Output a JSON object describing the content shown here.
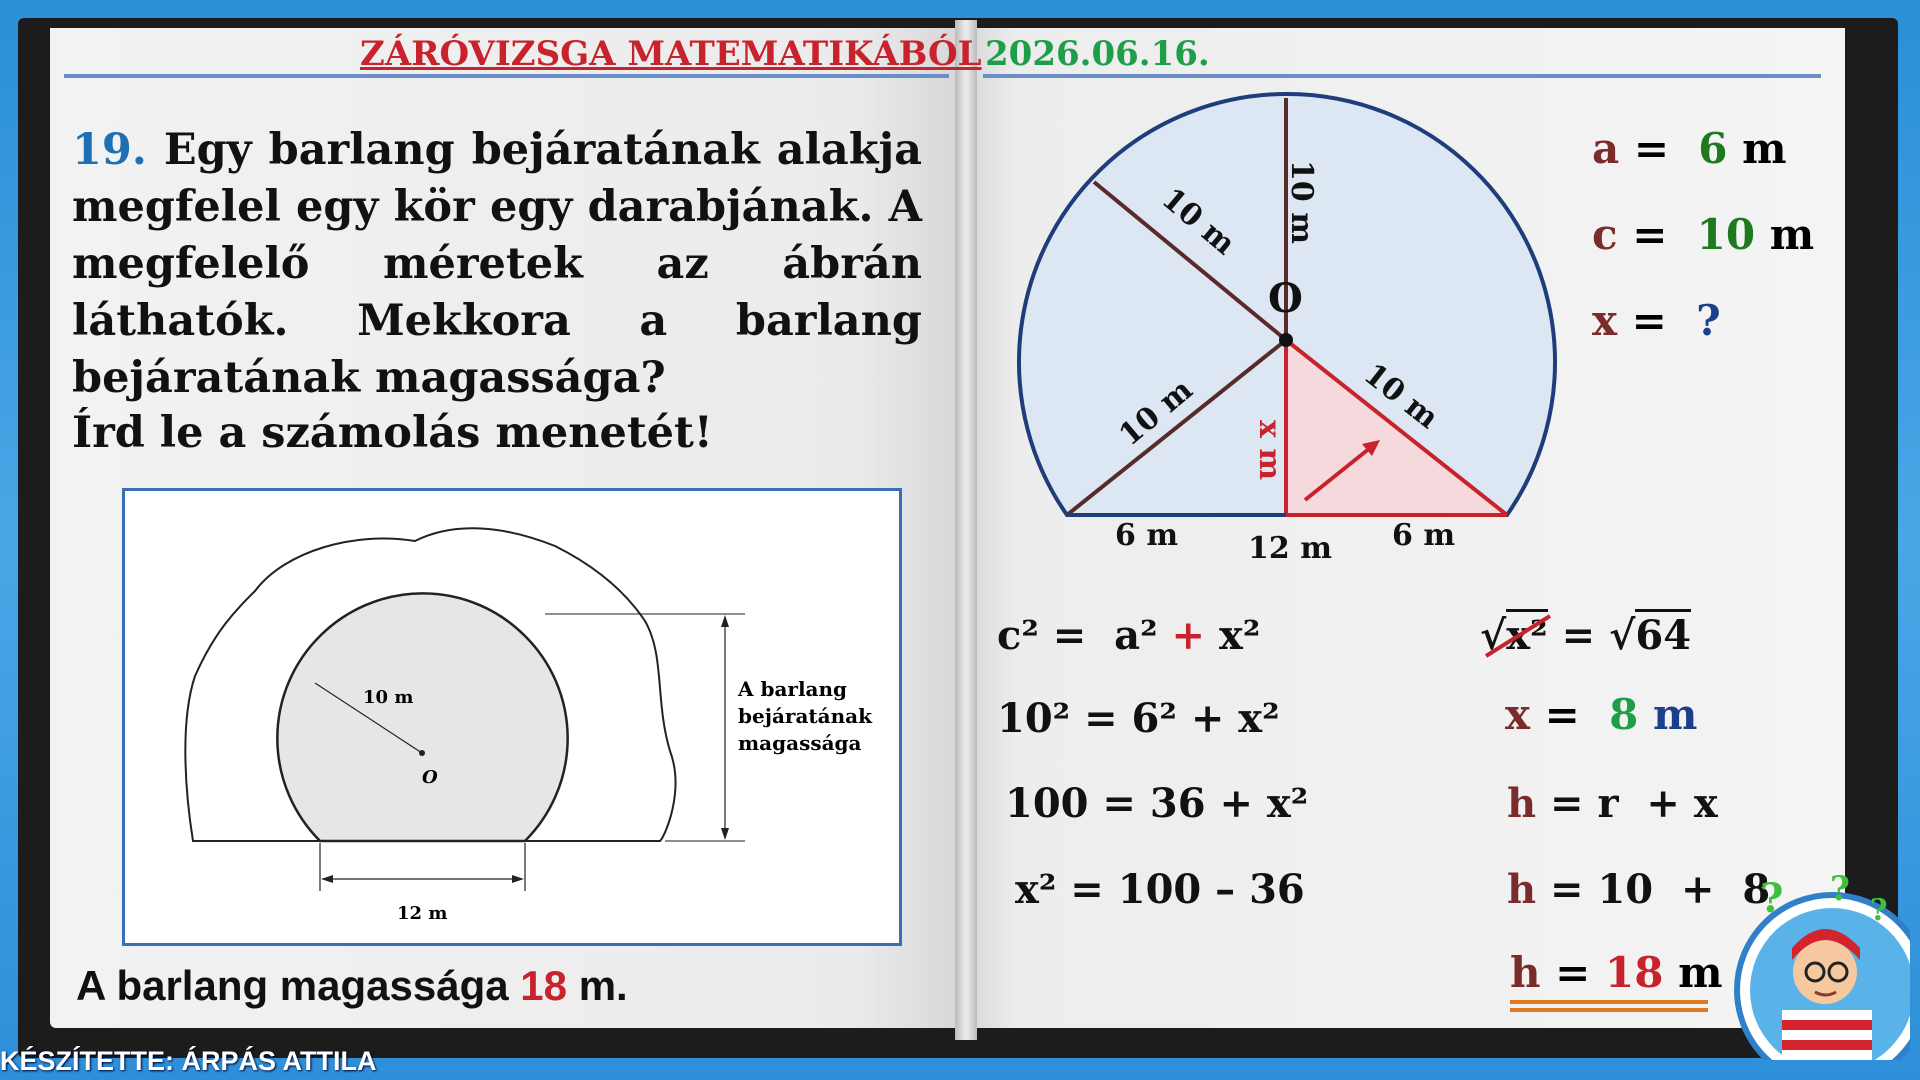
{
  "header": {
    "title": "ZÁRÓVIZSGA MATEMATIKÁBÓL",
    "date": "2026.06.16."
  },
  "problem": {
    "number": "19.",
    "text": "Egy barlang bejáratának alakja megfelel egy kör egy darabjának. A megfelelő méretek az ábrán láthatók. Mekkora a barlang bejáratának magassága?",
    "instruction": "Írd le a számolás menetét!"
  },
  "figure": {
    "radius_label": "10 m",
    "center_label": "O",
    "base_label": "12 m",
    "height_label_1": "A barlang",
    "height_label_2": "bejáratának",
    "height_label_3": "magassága"
  },
  "answer": {
    "prefix": "A barlang magassága",
    "value": "18",
    "unit": "m."
  },
  "footer": {
    "credit": "KÉSZÍTETTE: ÁRPÁS ATTILA"
  },
  "diagram": {
    "center": "O",
    "r_top": "10 m",
    "r_left": "10 m",
    "r_lower_left": "10 m",
    "r_lower_right": "10 m",
    "x_label": "x m",
    "base_left": "6 m",
    "base_mid": "12 m",
    "base_right": "6 m"
  },
  "givens": {
    "a": {
      "name": "a",
      "eq": "=",
      "value": "6",
      "unit": "m"
    },
    "c": {
      "name": "c",
      "eq": "=",
      "value": "10",
      "unit": "m"
    },
    "x": {
      "name": "x",
      "eq": "=",
      "value": "?"
    }
  },
  "solution_left": [
    "c² = a² + x²",
    "10² = 6² + x²",
    "100 = 36 + x²",
    "x² = 100 – 36"
  ],
  "solution_right": {
    "sqrt_lhs": "x²",
    "sqrt_eq": "=",
    "sqrt_rhs": "64",
    "x_name": "x",
    "x_eq": "=",
    "x_value": "8",
    "x_unit": "m",
    "h1": "h = r + x",
    "h2": "h = 10 + 8",
    "h3_name": "h",
    "h3_eq": "=",
    "h3_value": "18",
    "h3_unit": "m"
  },
  "colors": {
    "title_red": "#c8232c",
    "date_green": "#1f9e4a",
    "number_blue": "#1f6fb5",
    "var_brown": "#7a2c2c",
    "value_green": "#1f7a1f",
    "unit_navy": "#1c3f8c",
    "underline_orange": "#e07a22"
  }
}
